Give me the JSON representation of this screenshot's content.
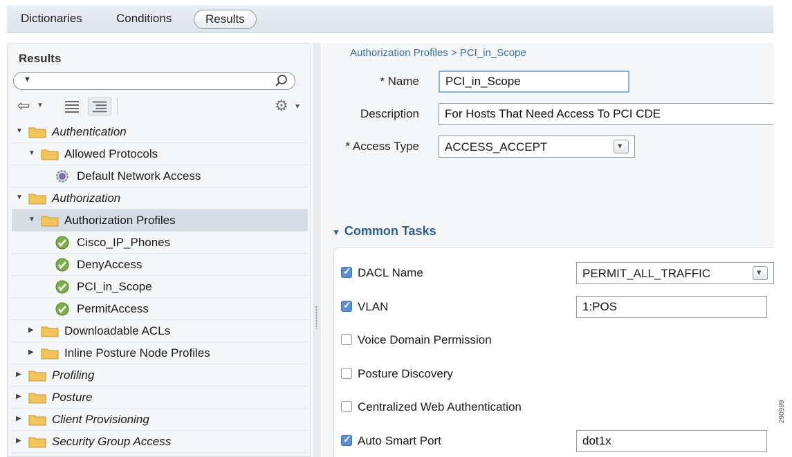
{
  "top_tabs": [
    "Dictionaries",
    "Conditions",
    "Results"
  ],
  "left_panel": {
    "title": "Results",
    "search": {
      "value": "",
      "placeholder": ""
    }
  },
  "tree": [
    {
      "label": "Authentication",
      "italic": true,
      "expanded": true,
      "icon": "folder-icon"
    },
    {
      "label": "Allowed Protocols",
      "italic": false,
      "expanded": true,
      "icon": "folder-icon"
    },
    {
      "label": "Default Network Access",
      "italic": false,
      "icon": "gear-icon"
    },
    {
      "label": "Authorization",
      "italic": true,
      "expanded": true,
      "icon": "folder-icon"
    },
    {
      "label": "Authorization Profiles",
      "italic": false,
      "expanded": true,
      "selected": true,
      "icon": "folder-icon"
    },
    {
      "label": "Cisco_IP_Phones",
      "italic": false,
      "icon": "check-shield-icon"
    },
    {
      "label": "DenyAccess",
      "italic": false,
      "icon": "check-shield-icon"
    },
    {
      "label": "PCI_in_Scope",
      "italic": false,
      "icon": "check-shield-icon"
    },
    {
      "label": "PermitAccess",
      "italic": false,
      "icon": "check-shield-icon"
    },
    {
      "label": "Downloadable ACLs",
      "italic": false,
      "expanded": false,
      "icon": "folder-icon"
    },
    {
      "label": "Inline Posture Node Profiles",
      "italic": false,
      "expanded": false,
      "icon": "folder-icon"
    },
    {
      "label": "Profiling",
      "italic": true,
      "expanded": false,
      "icon": "folder-icon"
    },
    {
      "label": "Posture",
      "italic": true,
      "expanded": false,
      "icon": "folder-icon"
    },
    {
      "label": "Client Provisioning",
      "italic": true,
      "expanded": false,
      "icon": "folder-icon"
    },
    {
      "label": "Security Group Access",
      "italic": true,
      "expanded": false,
      "icon": "folder-icon"
    }
  ],
  "form": {
    "breadcrumb": "Authorization Profiles > PCI_in_Scope",
    "name_label": "* Name",
    "name_value": "PCI_in_Scope",
    "description_label": "Description",
    "description_value": "For Hosts That Need Access To PCI CDE",
    "access_type_label": "* Access Type",
    "access_type_value": "ACCESS_ACCEPT"
  },
  "common_tasks": {
    "title": "Common Tasks",
    "items": [
      {
        "label": "DACL Name",
        "checked": true,
        "value": "PERMIT_ALL_TRAFFIC",
        "control": "select"
      },
      {
        "label": "VLAN",
        "checked": true,
        "value": "1:POS",
        "control": "input"
      },
      {
        "label": "Voice Domain Permission",
        "checked": false
      },
      {
        "label": "Posture Discovery",
        "checked": false
      },
      {
        "label": "Centralized Web Authentication",
        "checked": false
      },
      {
        "label": "Auto Smart Port",
        "checked": true,
        "value": "dot1x",
        "control": "input"
      }
    ]
  },
  "figure_id": "290999",
  "colors": {
    "accent": "#2e5f8f",
    "link": "#3a6fa5",
    "folder": "#f2c55c",
    "selected_row": "#d6dde4"
  }
}
